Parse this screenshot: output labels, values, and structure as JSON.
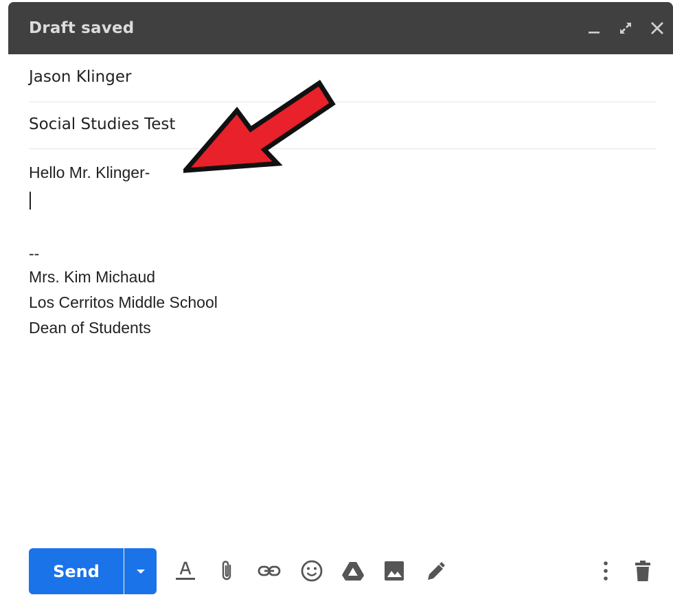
{
  "header": {
    "title": "Draft saved"
  },
  "compose": {
    "to_value": "Jason Klinger",
    "subject_value": "Social Studies Test",
    "body": {
      "greeting": "Hello Mr. Klinger-",
      "signature_separator": "--",
      "signature_lines": [
        "Mrs. Kim Michaud",
        "Los Cerritos Middle School",
        "Dean of Students"
      ]
    }
  },
  "toolbar": {
    "send_label": "Send"
  },
  "icons": {
    "header": [
      "minimize-icon",
      "fullscreen-icon",
      "close-icon"
    ],
    "footer": [
      "formatting-icon",
      "attach-icon",
      "link-icon",
      "emoji-icon",
      "drive-icon",
      "photo-icon",
      "signature-icon",
      "more-options-icon",
      "delete-icon"
    ]
  },
  "colors": {
    "header_bg": "#404040",
    "send_blue": "#1a73e8",
    "annotation_arrow": "#e8212b"
  }
}
